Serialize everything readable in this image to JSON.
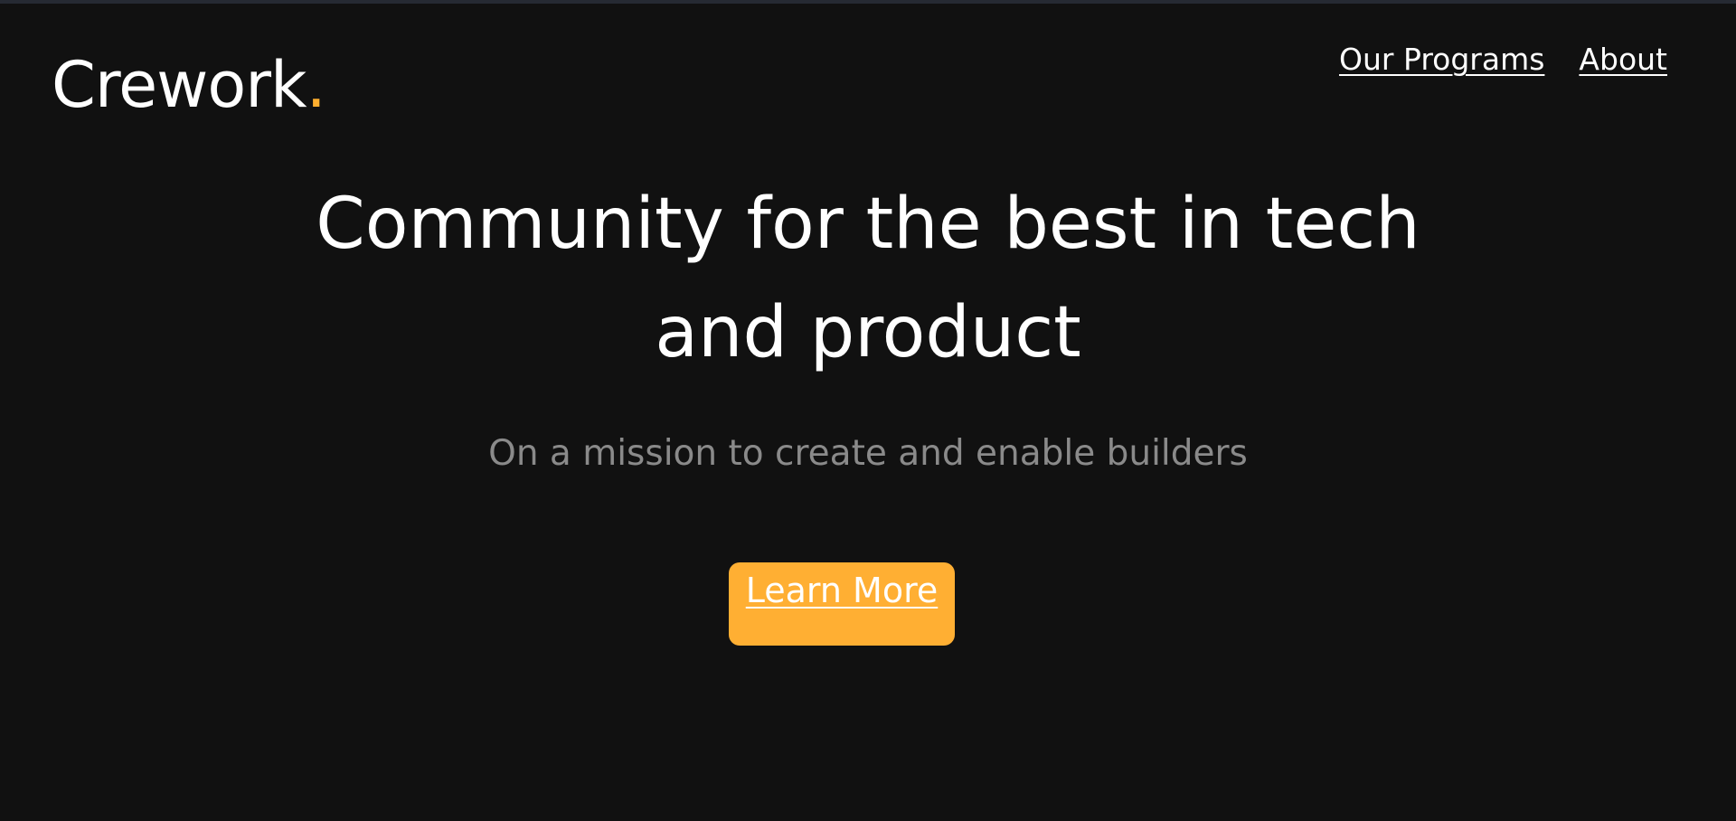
{
  "header": {
    "logo_text": "Crework",
    "logo_dot": ".",
    "nav": [
      {
        "label": "Our Programs"
      },
      {
        "label": "About"
      }
    ]
  },
  "hero": {
    "title_line1": "Community for the best in tech",
    "title_line2": "and product",
    "subtitle": "On a mission to create and enable builders",
    "cta_label": "Learn More"
  },
  "colors": {
    "background": "#111111",
    "accent": "#ffaf33",
    "text": "#ffffff",
    "muted_text": "#8a8a8a"
  }
}
